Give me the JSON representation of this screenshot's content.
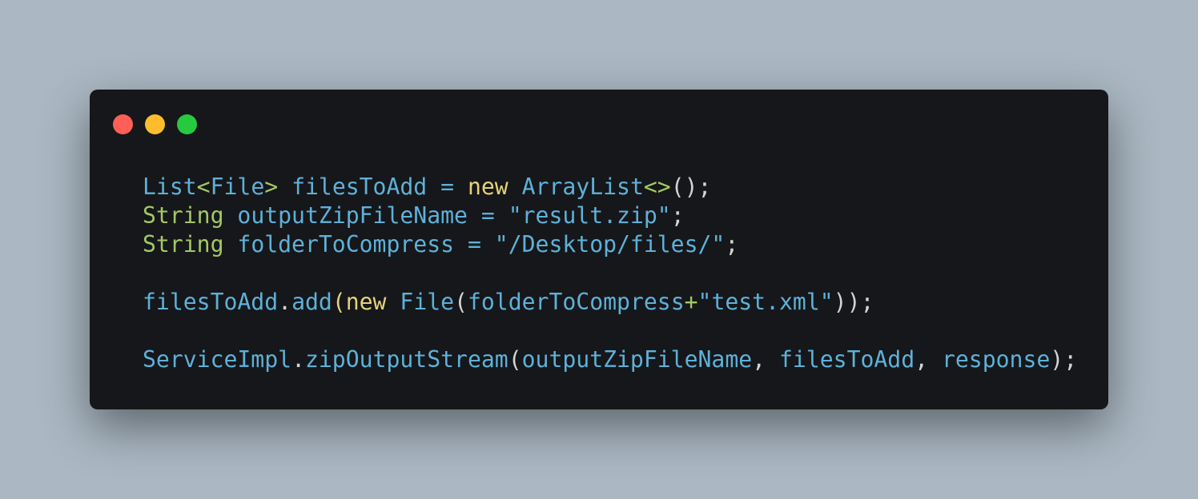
{
  "colors": {
    "background": "#abb8c3",
    "window": "#16171a",
    "close": "#ff5f56",
    "minimize": "#ffbd2e",
    "maximize": "#27c93f",
    "identifier": "#5eb1d9",
    "keyword": "#e6d27a",
    "type": "#a3c965",
    "string": "#5eb1d9",
    "punctuation": "#d4d4d4"
  },
  "window_controls": [
    {
      "name": "close-dot",
      "color": "#ff5f56"
    },
    {
      "name": "minimize-dot",
      "color": "#ffbd2e"
    },
    {
      "name": "maximize-dot",
      "color": "#27c93f"
    }
  ],
  "code_lines": [
    {
      "tokens": [
        {
          "text": "List",
          "kind": "identifier"
        },
        {
          "text": "<",
          "kind": "type"
        },
        {
          "text": "File",
          "kind": "identifier"
        },
        {
          "text": ">",
          "kind": "type"
        },
        {
          "text": " ",
          "kind": "punctuation"
        },
        {
          "text": "filesToAdd",
          "kind": "identifier"
        },
        {
          "text": " ",
          "kind": "punctuation"
        },
        {
          "text": "=",
          "kind": "identifier"
        },
        {
          "text": " ",
          "kind": "punctuation"
        },
        {
          "text": "new",
          "kind": "keyword"
        },
        {
          "text": " ",
          "kind": "punctuation"
        },
        {
          "text": "ArrayList",
          "kind": "identifier"
        },
        {
          "text": "<>",
          "kind": "type"
        },
        {
          "text": "();",
          "kind": "punctuation"
        }
      ]
    },
    {
      "tokens": [
        {
          "text": "String",
          "kind": "type"
        },
        {
          "text": " ",
          "kind": "punctuation"
        },
        {
          "text": "outputZipFileName",
          "kind": "identifier"
        },
        {
          "text": " ",
          "kind": "punctuation"
        },
        {
          "text": "=",
          "kind": "identifier"
        },
        {
          "text": " ",
          "kind": "punctuation"
        },
        {
          "text": "\"result.zip\"",
          "kind": "string"
        },
        {
          "text": ";",
          "kind": "punctuation"
        }
      ]
    },
    {
      "tokens": [
        {
          "text": "String",
          "kind": "type"
        },
        {
          "text": " ",
          "kind": "punctuation"
        },
        {
          "text": "folderToCompress",
          "kind": "identifier"
        },
        {
          "text": " ",
          "kind": "punctuation"
        },
        {
          "text": "=",
          "kind": "identifier"
        },
        {
          "text": " ",
          "kind": "punctuation"
        },
        {
          "text": "\"/Desktop/files/\"",
          "kind": "string"
        },
        {
          "text": ";",
          "kind": "punctuation"
        }
      ]
    },
    {
      "tokens": []
    },
    {
      "tokens": [
        {
          "text": "filesToAdd",
          "kind": "identifier"
        },
        {
          "text": ".",
          "kind": "punctuation"
        },
        {
          "text": "add",
          "kind": "identifier"
        },
        {
          "text": "(",
          "kind": "keyword"
        },
        {
          "text": "new",
          "kind": "keyword"
        },
        {
          "text": " ",
          "kind": "punctuation"
        },
        {
          "text": "File",
          "kind": "identifier"
        },
        {
          "text": "(",
          "kind": "punctuation"
        },
        {
          "text": "folderToCompress",
          "kind": "identifier"
        },
        {
          "text": "+",
          "kind": "type"
        },
        {
          "text": "\"test.xml\"",
          "kind": "string"
        },
        {
          "text": "));",
          "kind": "punctuation"
        }
      ]
    },
    {
      "tokens": []
    },
    {
      "tokens": [
        {
          "text": "ServiceImpl",
          "kind": "identifier"
        },
        {
          "text": ".",
          "kind": "punctuation"
        },
        {
          "text": "zipOutputStream",
          "kind": "identifier"
        },
        {
          "text": "(",
          "kind": "punctuation"
        },
        {
          "text": "outputZipFileName",
          "kind": "identifier"
        },
        {
          "text": ", ",
          "kind": "punctuation"
        },
        {
          "text": "filesToAdd",
          "kind": "identifier"
        },
        {
          "text": ", ",
          "kind": "punctuation"
        },
        {
          "text": "response",
          "kind": "identifier"
        },
        {
          "text": ");",
          "kind": "punctuation"
        }
      ]
    }
  ]
}
